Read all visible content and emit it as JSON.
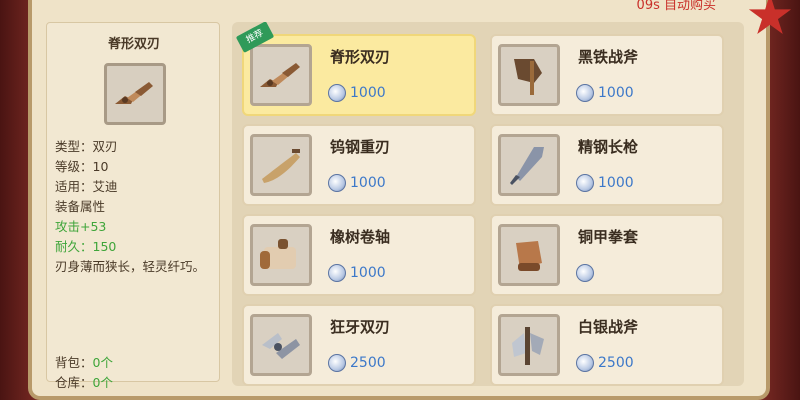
{
  "header": {
    "auto_buy_label": "09s 自动购买"
  },
  "detail": {
    "title": "脊形双刃",
    "lines": [
      "类型：双刃",
      "等级：10",
      "适用：艾迪",
      "装备属性"
    ],
    "attack": "攻击+53",
    "durability": "耐久：150",
    "description": "刃身薄而狭长，轻灵纤巧。",
    "bag_label": "背包：",
    "bag_value": "0个",
    "storage_label": "仓库：",
    "storage_value": "0个"
  },
  "shop": {
    "badge": "推荐",
    "items": [
      {
        "name": "脊形双刃",
        "price": "1000",
        "icon": "twin-blade-icon"
      },
      {
        "name": "黑铁战斧",
        "price": "1000",
        "icon": "black-iron-axe-icon"
      },
      {
        "name": "钨钢重刃",
        "price": "1000",
        "icon": "tungsten-heavy-blade-icon"
      },
      {
        "name": "精钢长枪",
        "price": "1000",
        "icon": "steel-spear-icon"
      },
      {
        "name": "橡树卷轴",
        "price": "1000",
        "icon": "oak-scroll-icon"
      },
      {
        "name": "铜甲拳套",
        "price": "",
        "icon": "bronze-gauntlet-icon"
      },
      {
        "name": "狂牙双刃",
        "price": "2500",
        "icon": "fang-twin-blade-icon"
      },
      {
        "name": "白银战斧",
        "price": "2500",
        "icon": "silver-axe-icon"
      }
    ]
  },
  "colors": {
    "price": "#3c78c9",
    "stat_green": "#3fa53a",
    "selected_card": "#fbeaa0"
  }
}
